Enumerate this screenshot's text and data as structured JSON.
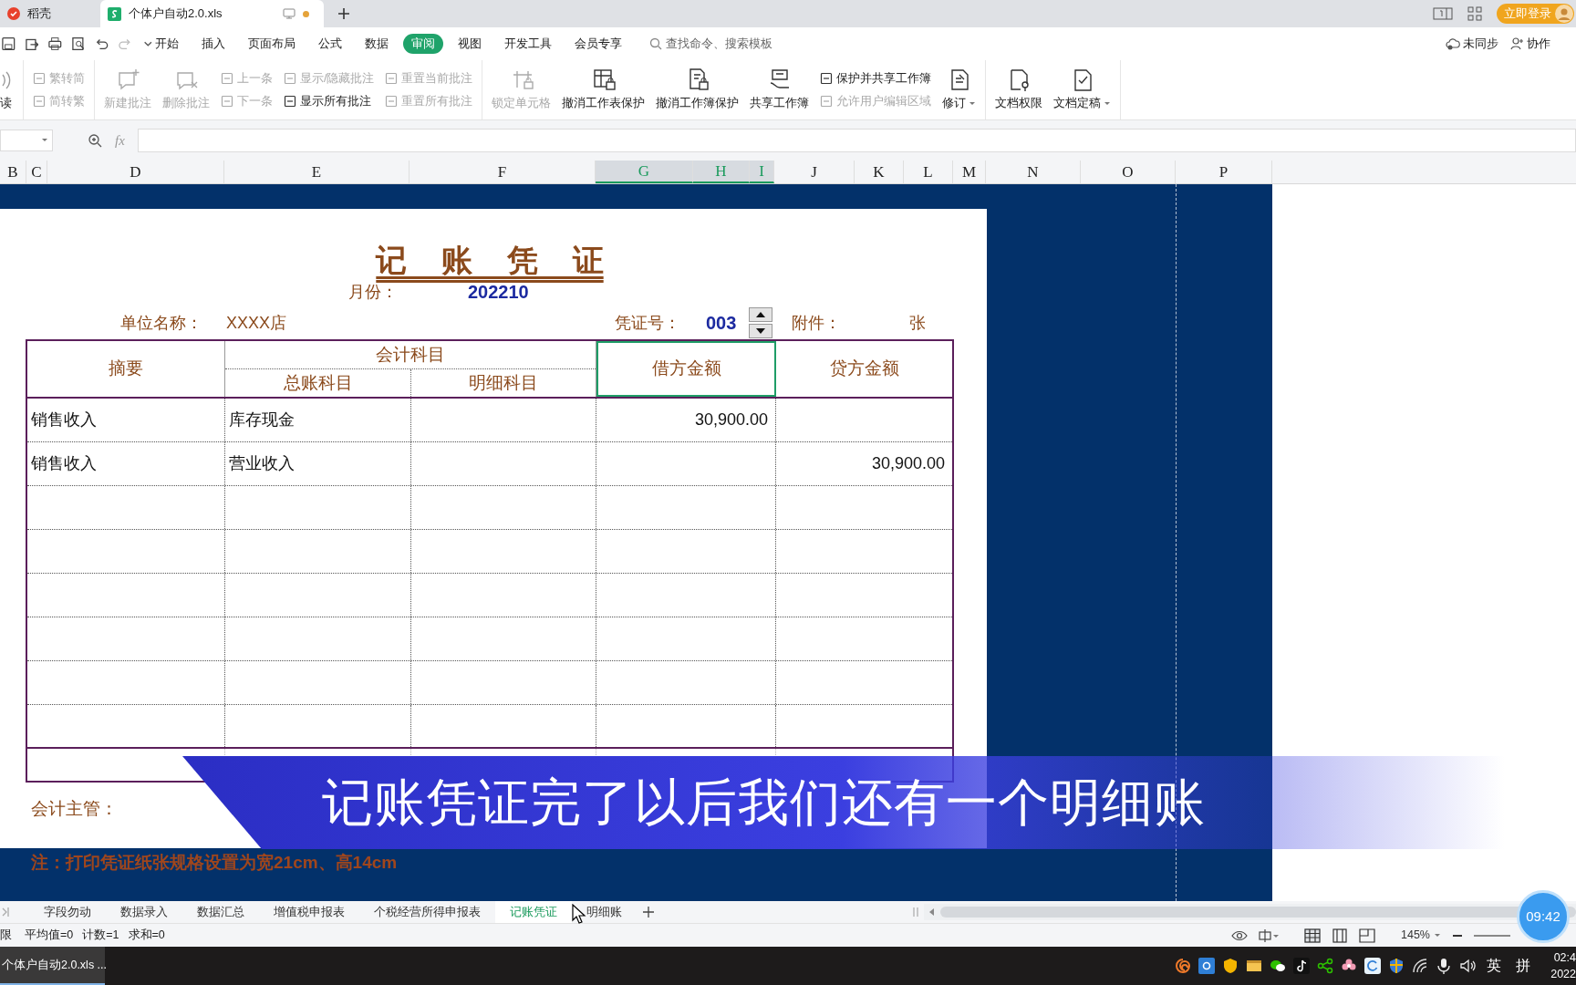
{
  "title_bar": {
    "tabs": [
      {
        "label": "稻壳",
        "kind": "docer",
        "selected": false
      },
      {
        "label": "个体户自动2.0.xls",
        "kind": "sheet",
        "selected": true,
        "unsaved": true
      }
    ],
    "login_button": "立即登录"
  },
  "menu": {
    "tabs": [
      {
        "label": "开始",
        "selected": false
      },
      {
        "label": "插入",
        "selected": false
      },
      {
        "label": "页面布局",
        "selected": false
      },
      {
        "label": "公式",
        "selected": false
      },
      {
        "label": "数据",
        "selected": false
      },
      {
        "label": "审阅",
        "selected": true
      },
      {
        "label": "视图",
        "selected": false
      },
      {
        "label": "开发工具",
        "selected": false
      },
      {
        "label": "会员专享",
        "selected": false
      }
    ],
    "search_placeholder": "查找命令、搜索模板",
    "actions": [
      "未同步",
      "协作"
    ]
  },
  "ribbon": {
    "groups": [
      {
        "items": [
          {
            "kind": "large",
            "label": "读",
            "disabled": false
          }
        ]
      },
      {
        "items": [
          {
            "kind": "stack",
            "entries": [
              {
                "label": "繁转简",
                "disabled": true
              },
              {
                "label": "简转繁",
                "disabled": true
              }
            ]
          }
        ]
      },
      {
        "items": [
          {
            "kind": "large",
            "label": "新建批注",
            "disabled": true
          },
          {
            "kind": "large",
            "label": "删除批注",
            "disabled": true
          },
          {
            "kind": "stack",
            "entries": [
              {
                "label": "上一条",
                "disabled": true
              },
              {
                "label": "下一条",
                "disabled": true
              }
            ]
          },
          {
            "kind": "stack",
            "entries": [
              {
                "label": "显示/隐藏批注",
                "disabled": true
              },
              {
                "label": "显示所有批注",
                "disabled": false
              }
            ]
          },
          {
            "kind": "stack",
            "entries": [
              {
                "label": "重置当前批注",
                "disabled": true
              },
              {
                "label": "重置所有批注",
                "disabled": true
              }
            ]
          }
        ]
      },
      {
        "items": [
          {
            "kind": "large",
            "label": "锁定单元格",
            "disabled": true
          },
          {
            "kind": "large",
            "label": "撤消工作表保护",
            "disabled": false
          },
          {
            "kind": "large",
            "label": "撤消工作簿保护",
            "disabled": false
          },
          {
            "kind": "large",
            "label": "共享工作簿",
            "disabled": false
          },
          {
            "kind": "stack",
            "entries": [
              {
                "label": "保护并共享工作簿",
                "disabled": false
              },
              {
                "label": "允许用户编辑区域",
                "disabled": true
              }
            ]
          },
          {
            "kind": "large",
            "label": "修订",
            "disabled": false,
            "has_menu": true
          }
        ]
      },
      {
        "items": [
          {
            "kind": "large",
            "label": "文档权限",
            "disabled": false
          },
          {
            "kind": "large",
            "label": "文档定稿",
            "disabled": false,
            "has_menu": true
          }
        ]
      }
    ]
  },
  "formula_bar": {
    "function_label": "fx"
  },
  "columns": [
    {
      "label": "B",
      "selected": false
    },
    {
      "label": "C",
      "selected": false
    },
    {
      "label": "D",
      "selected": false
    },
    {
      "label": "E",
      "selected": false
    },
    {
      "label": "F",
      "selected": false
    },
    {
      "label": "G",
      "selected": true
    },
    {
      "label": "H",
      "selected": true
    },
    {
      "label": "I",
      "selected": true
    },
    {
      "label": "J",
      "selected": false
    },
    {
      "label": "K",
      "selected": false
    },
    {
      "label": "L",
      "selected": false
    },
    {
      "label": "M",
      "selected": false
    },
    {
      "label": "N",
      "selected": false
    },
    {
      "label": "O",
      "selected": false
    },
    {
      "label": "P",
      "selected": false
    }
  ],
  "voucher": {
    "title": "记 账 凭 证",
    "month_label": "月份：",
    "month": "202210",
    "unit_label": "单位名称：",
    "unit": "XXXX店",
    "number_label": "凭证号：",
    "number": "003",
    "attachments_label": "附件：",
    "attachments_unit": "张",
    "headers": {
      "summary": "摘要",
      "account": "会计科目",
      "general_ledger": "总账科目",
      "detail": "明细科目",
      "debit": "借方金额",
      "credit": "贷方金额"
    },
    "debit_selected": true,
    "rows": [
      {
        "summary": "销售收入",
        "general_ledger": "库存现金",
        "debit": "30,900.00"
      },
      {
        "summary": "销售收入",
        "general_ledger": "营业收入",
        "credit": "30,900.00"
      }
    ],
    "supervisor_label": "会计主管：",
    "note": "注：打印凭证纸张规格设置为宽21cm、高14cm"
  },
  "caption": "记账凭证完了以后我们还有一个明细账",
  "sheet_tabs": [
    {
      "label": "字段勿动",
      "selected": false
    },
    {
      "label": "数据录入",
      "selected": false
    },
    {
      "label": "数据汇总",
      "selected": false
    },
    {
      "label": "增值税申报表",
      "selected": false
    },
    {
      "label": "个税经营所得申报表",
      "selected": false
    },
    {
      "label": "记账凭证",
      "selected": true
    },
    {
      "label": "明细账",
      "selected": false
    }
  ],
  "status_bar": {
    "stats": [
      "限",
      "平均值=0",
      "计数=1",
      "求和=0"
    ],
    "zoom": "145%"
  },
  "taskbar": {
    "window": "个体户自动2.0.xls ...",
    "tray": [
      "英",
      "拼"
    ],
    "time": "02:4",
    "date": "2022"
  },
  "timer": "09:42"
}
